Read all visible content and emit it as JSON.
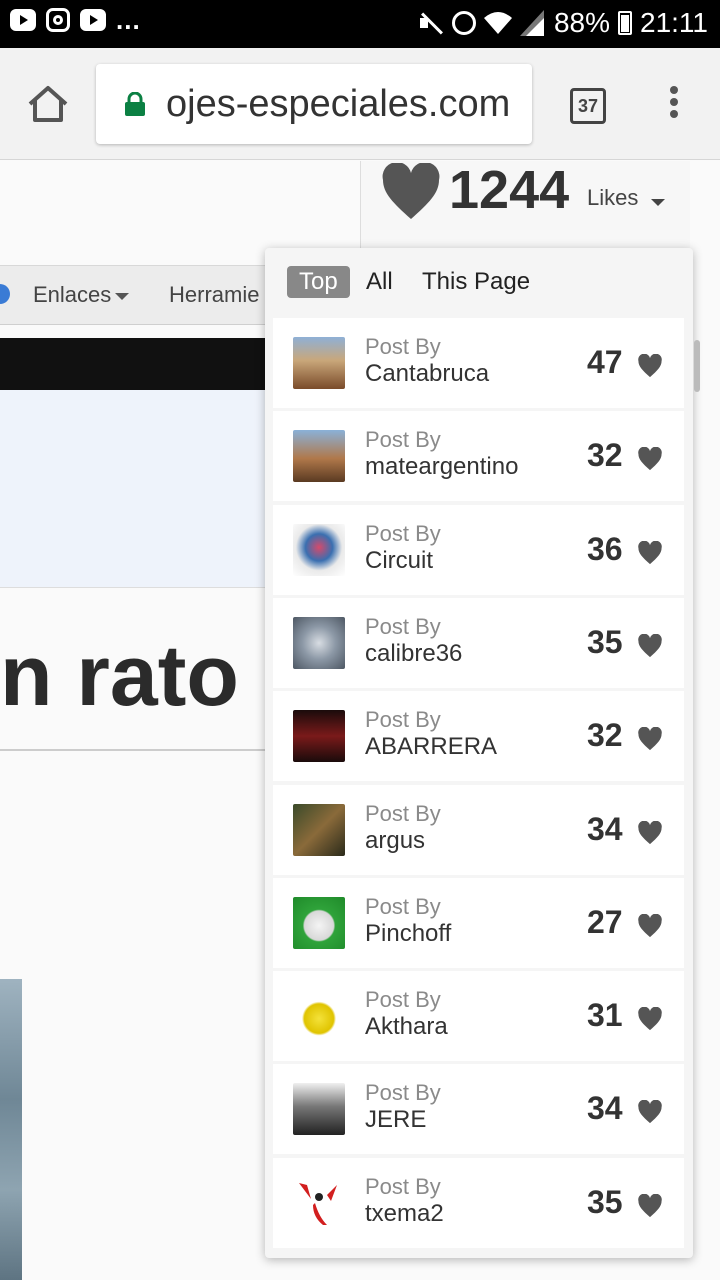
{
  "status_bar": {
    "app_icons": [
      "youtube-icon",
      "instagram-icon",
      "youtube-icon"
    ],
    "overflow": "...",
    "battery": "88%",
    "time": "21:11"
  },
  "browser": {
    "url": "ojes-especiales.com",
    "tab_count": "37"
  },
  "likes": {
    "count": "1244",
    "label": "Likes"
  },
  "nav": {
    "enlaces": "Enlaces",
    "herramientas": "Herramie"
  },
  "headline": "n rato",
  "dropdown": {
    "tabs": [
      "Top",
      "All",
      "This Page"
    ],
    "post_by_label": "Post By",
    "rows": [
      {
        "user": "Cantabruca",
        "count": "47"
      },
      {
        "user": "mateargentino",
        "count": "32"
      },
      {
        "user": "Circuit",
        "count": "36"
      },
      {
        "user": "calibre36",
        "count": "35"
      },
      {
        "user": "ABARRERA",
        "count": "32"
      },
      {
        "user": "argus",
        "count": "34"
      },
      {
        "user": "Pinchoff",
        "count": "27"
      },
      {
        "user": "Akthara",
        "count": "31"
      },
      {
        "user": "JERE",
        "count": "34"
      },
      {
        "user": "txema2",
        "count": "35"
      }
    ]
  },
  "colors": {
    "active_tab_bg": "#888888",
    "heart": "#555555",
    "lock": "#0b8043"
  }
}
